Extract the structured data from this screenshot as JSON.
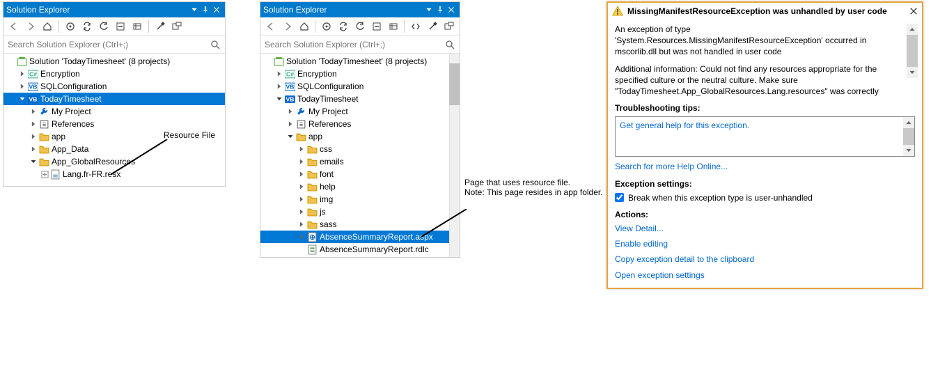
{
  "panel1": {
    "title": "Solution Explorer",
    "searchPlaceholder": "Search Solution Explorer (Ctrl+;)",
    "tree": [
      {
        "d": 0,
        "exp": "",
        "icon": "sln",
        "text": "Solution 'TodayTimesheet' (8 projects)"
      },
      {
        "d": 1,
        "exp": "r",
        "icon": "cs",
        "text": "Encryption"
      },
      {
        "d": 1,
        "exp": "r",
        "icon": "vb",
        "text": "SQLConfiguration"
      },
      {
        "d": 1,
        "exp": "d",
        "icon": "vbproj",
        "text": "TodayTimesheet",
        "sel": true
      },
      {
        "d": 2,
        "exp": "r",
        "icon": "wrench",
        "text": "My Project"
      },
      {
        "d": 2,
        "exp": "r",
        "icon": "ref",
        "text": "References"
      },
      {
        "d": 2,
        "exp": "r",
        "icon": "folder",
        "text": "app"
      },
      {
        "d": 2,
        "exp": "r",
        "icon": "folder",
        "text": "App_Data"
      },
      {
        "d": 2,
        "exp": "d",
        "icon": "folder",
        "text": "App_GlobalResources"
      },
      {
        "d": 3,
        "exp": "+",
        "icon": "resx",
        "text": "Lang.fr-FR.resx"
      }
    ]
  },
  "panel2": {
    "title": "Solution Explorer",
    "searchPlaceholder": "Search Solution Explorer (Ctrl+;)",
    "tree": [
      {
        "d": 0,
        "exp": "",
        "icon": "sln",
        "text": "Solution 'TodayTimesheet' (8 projects)"
      },
      {
        "d": 1,
        "exp": "r",
        "icon": "cs",
        "text": "Encryption"
      },
      {
        "d": 1,
        "exp": "r",
        "icon": "vb",
        "text": "SQLConfiguration"
      },
      {
        "d": 1,
        "exp": "d",
        "icon": "vbproj",
        "text": "TodayTimesheet"
      },
      {
        "d": 2,
        "exp": "r",
        "icon": "wrench",
        "text": "My Project"
      },
      {
        "d": 2,
        "exp": "r",
        "icon": "ref",
        "text": "References"
      },
      {
        "d": 2,
        "exp": "d",
        "icon": "folder",
        "text": "app"
      },
      {
        "d": 3,
        "exp": "r",
        "icon": "folder",
        "text": "css"
      },
      {
        "d": 3,
        "exp": "r",
        "icon": "folder",
        "text": "emails"
      },
      {
        "d": 3,
        "exp": "r",
        "icon": "folder",
        "text": "font"
      },
      {
        "d": 3,
        "exp": "r",
        "icon": "folder",
        "text": "help"
      },
      {
        "d": 3,
        "exp": "r",
        "icon": "folder",
        "text": "img"
      },
      {
        "d": 3,
        "exp": "r",
        "icon": "folder",
        "text": "js"
      },
      {
        "d": 3,
        "exp": "r",
        "icon": "folder",
        "text": "sass"
      },
      {
        "d": 3,
        "exp": "r",
        "icon": "aspx",
        "text": "AbsenceSummaryReport.aspx",
        "sel": true
      },
      {
        "d": 3,
        "exp": "",
        "icon": "rdlc",
        "text": "AbsenceSummaryReport.rdlc"
      }
    ]
  },
  "annot1": "Resource File",
  "annot2": "Page that uses resource file.\nNote: This page resides in app folder.",
  "exception": {
    "title": "MissingManifestResourceException was unhandled by user code",
    "msg1": "An exception of type 'System.Resources.MissingManifestResourceException' occurred in mscorlib.dll but was not handled in user code",
    "msg2": "Additional information: Could not find any resources appropriate for the specified culture or the neutral culture.  Make sure \"TodayTimesheet.App_GlobalResources.Lang.resources\" was correctly",
    "tipsLabel": "Troubleshooting tips:",
    "tip1": "Get general help for this exception.",
    "searchHelp": "Search for more Help Online...",
    "settingsLabel": "Exception settings:",
    "checkbox": "Break when this exception type is user-unhandled",
    "actionsLabel": "Actions:",
    "action1": "View Detail...",
    "action2": "Enable editing",
    "action3": "Copy exception detail to the clipboard",
    "action4": "Open exception settings"
  }
}
